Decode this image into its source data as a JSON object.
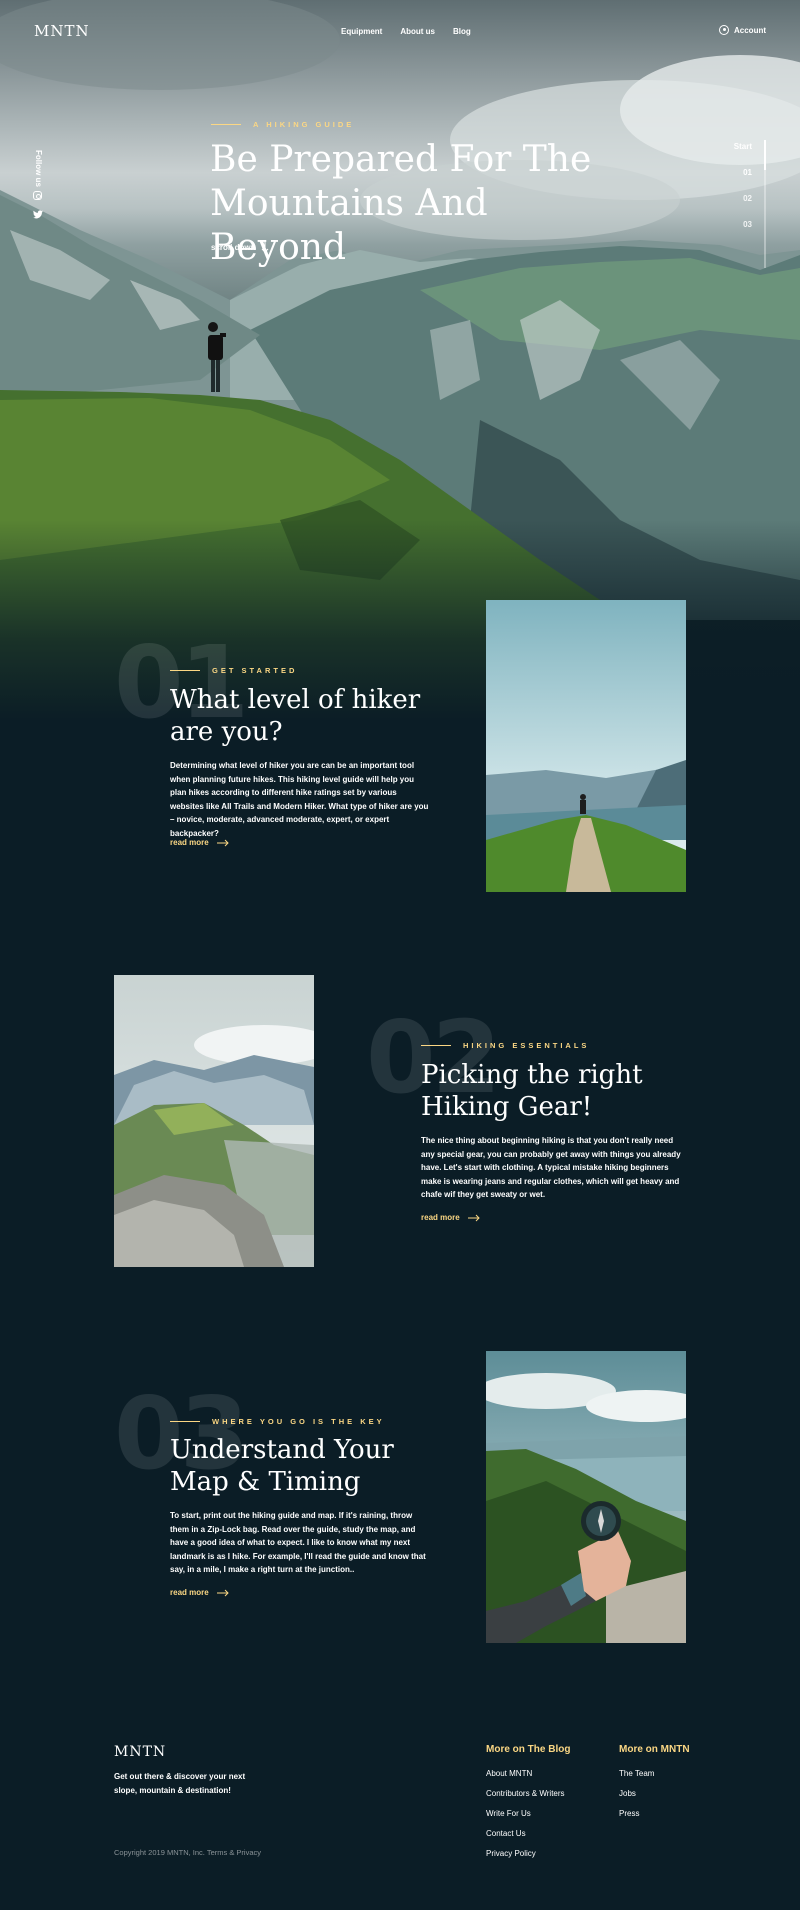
{
  "header": {
    "logo": "MNTN",
    "nav": [
      "Equipment",
      "About us",
      "Blog"
    ],
    "account_label": "Account"
  },
  "hero": {
    "follow_label": "Follow us",
    "eyebrow": "A HIKING GUIDE",
    "title": "Be Prepared For The Mountains And Beyond",
    "scroll_label": "scroll down",
    "slider": {
      "items": [
        "Start",
        "01",
        "02",
        "03"
      ],
      "active": "Start"
    }
  },
  "sections": [
    {
      "number": "01",
      "eyebrow": "GET STARTED",
      "title": "What level of hiker are you?",
      "text": "Determining what level of hiker you are can be an important tool when planning future hikes. This hiking level guide will help you plan hikes according to different hike ratings set by various websites like All Trails and Modern Hiker. What type of hiker are you – novice, moderate, advanced moderate, expert, or expert backpacker?",
      "read_more": "read more"
    },
    {
      "number": "02",
      "eyebrow": "HIKING ESSENTIALS",
      "title": "Picking the right Hiking Gear!",
      "text": "The nice thing about beginning hiking is that you don't really need any special gear, you can probably get away with things you already have. Let's start with clothing. A typical mistake hiking beginners make is wearing jeans and regular clothes, which will get heavy and chafe wif they get sweaty or wet.",
      "read_more": "read more"
    },
    {
      "number": "03",
      "eyebrow": "WHERE YOU GO IS THE KEY",
      "title": "Understand Your Map & Timing",
      "text": "To start, print out the hiking guide and map. If it's raining, throw them in a Zip-Lock bag. Read over the guide, study the map, and have a good idea of what to expect. I like to know what my next landmark is as I hike. For example, I'll read the guide and know that say, in a mile, I make a right turn at the junction..",
      "read_more": "read more"
    }
  ],
  "footer": {
    "logo": "MNTN",
    "tagline": "Get out there & discover your next slope, mountain & destination!",
    "copyright": "Copyright 2019 MNTN, Inc. Terms & Privacy",
    "columns": [
      {
        "title": "More on The Blog",
        "links": [
          "About MNTN",
          "Contributors & Writers",
          "Write For Us",
          "Contact Us",
          "Privacy Policy"
        ]
      },
      {
        "title": "More on MNTN",
        "links": [
          "The Team",
          "Jobs",
          "Press"
        ]
      }
    ]
  },
  "colors": {
    "background": "#0b1d26",
    "accent": "#fbd784",
    "text": "#ffffff"
  }
}
